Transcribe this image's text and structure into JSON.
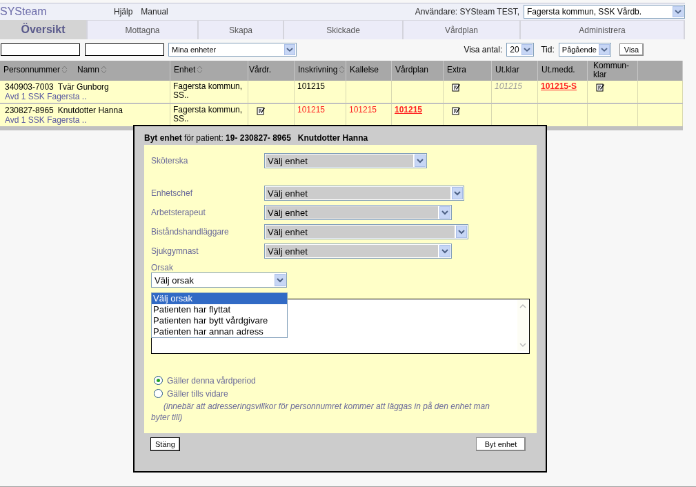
{
  "header": {
    "brand": "SYSteam",
    "links": [
      "Hjälp",
      "Manual"
    ],
    "user_label": "Användare: SYSteam TEST,",
    "unit_select": "Fagersta kommun, SSK Vårdb."
  },
  "tabs": [
    {
      "label": "Översikt",
      "selected": true
    },
    {
      "label": "Mottagna",
      "selected": false
    },
    {
      "label": "Skapa",
      "selected": false
    },
    {
      "label": "Skickade",
      "selected": false
    },
    {
      "label": "Vårdplan",
      "selected": false
    },
    {
      "label": "Administrera",
      "selected": false
    }
  ],
  "filters": {
    "unit_filter": "Mina enheter",
    "count_label": "Visa antal:",
    "count_value": "20",
    "time_label": "Tid:",
    "time_value": "Pågående",
    "show_button": "Visa"
  },
  "table": {
    "person_columns": [
      {
        "label": "Personnummer",
        "sortable": true
      },
      {
        "label": "Namn",
        "sortable": true
      }
    ],
    "columns": [
      {
        "label": "Enhet",
        "sortable": true
      },
      {
        "label": "Vårdr.",
        "sortable": false
      },
      {
        "label": "Inskrivning",
        "sortable": true
      },
      {
        "label": "Kallelse",
        "sortable": false
      },
      {
        "label": "Vårdplan",
        "sortable": false
      },
      {
        "label": "Extra",
        "sortable": false
      },
      {
        "label": "Ut.klar",
        "sortable": false
      },
      {
        "label": "Ut.medd.",
        "sortable": false
      },
      {
        "label": "Kommun-klar",
        "sortable": false
      }
    ],
    "rows": [
      {
        "person": {
          "personnummer": "340903-7003",
          "namn": "Tvär Gunborg",
          "unit": "Avd 1 SSK Fagersta .."
        },
        "cells": [
          {
            "kind": "plain",
            "text": "Fagersta kommun, SS.."
          },
          {
            "kind": "empty"
          },
          {
            "kind": "plain",
            "text": "101215"
          },
          {
            "kind": "empty"
          },
          {
            "kind": "empty"
          },
          {
            "kind": "icon"
          },
          {
            "kind": "muted",
            "text": "101215"
          },
          {
            "kind": "link",
            "text": "101215-S"
          },
          {
            "kind": "icon"
          }
        ]
      },
      {
        "person": {
          "personnummer": "230827-8965",
          "namn": "Knutdotter Hanna",
          "unit": "Avd 1 SSK Fagersta .."
        },
        "cells": [
          {
            "kind": "plain",
            "text": "Fagersta kommun, SS.."
          },
          {
            "kind": "icon"
          },
          {
            "kind": "red",
            "text": "101215"
          },
          {
            "kind": "red",
            "text": "101215"
          },
          {
            "kind": "link",
            "text": "101215"
          },
          {
            "kind": "icon"
          },
          {
            "kind": "empty"
          },
          {
            "kind": "empty"
          },
          {
            "kind": "empty"
          }
        ]
      }
    ]
  },
  "dialog": {
    "title": "Byt enhet",
    "patient_label": "för patient:",
    "patient_id": "19- 230827- 8965",
    "patient_name": "Knutdotter Hanna",
    "role_groups": [
      [
        {
          "label": "Sköterska",
          "value": "Välj enhet"
        }
      ],
      [
        {
          "label": "Enhetschef",
          "value": "Välj enhet"
        },
        {
          "label": "Arbetsterapeut",
          "value": "Välj enhet"
        },
        {
          "label": "Biståndshandläggare",
          "value": "Välj enhet"
        },
        {
          "label": "Sjukgymnast",
          "value": "Välj enhet"
        }
      ]
    ],
    "reason_label": "Orsak",
    "reason_value": "Välj orsak",
    "reason_options": [
      {
        "label": "Välj orsak",
        "selected": true
      },
      {
        "label": "Patienten har flyttat",
        "selected": false
      },
      {
        "label": "Patienten har bytt vårdgivare",
        "selected": false
      },
      {
        "label": "Patienten har annan adress",
        "selected": false
      }
    ],
    "periods": [
      {
        "label": "Gäller denna vårdperiod",
        "selected": true
      },
      {
        "label": "Gäller tills vidare",
        "selected": false
      }
    ],
    "note": "(innebär att adresseringsvillkor för personnumret kommer att läggas in på den enhet man byter till)",
    "close_button": "Stäng",
    "submit_button": "Byt enhet"
  }
}
